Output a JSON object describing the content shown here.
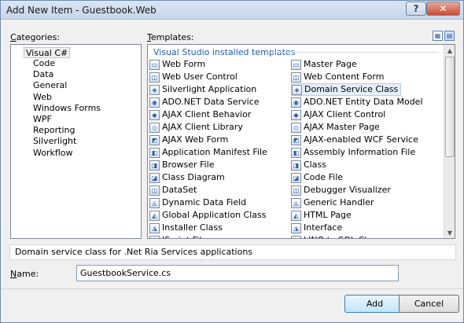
{
  "window": {
    "title": "Add New Item - Guestbook.Web"
  },
  "titlebar": {
    "help": "?",
    "close": "✕"
  },
  "categories": {
    "label_pre": "",
    "label_key": "C",
    "label_post": "ategories:",
    "root": "Visual C#",
    "items": [
      "Code",
      "Data",
      "General",
      "Web",
      "Windows Forms",
      "WPF",
      "Reporting",
      "Silverlight",
      "Workflow"
    ]
  },
  "templates": {
    "label_key": "T",
    "label_post": "emplates:",
    "group_header": "Visual Studio installed templates",
    "left": [
      "Web Form",
      "Web User Control",
      "Silverlight Application",
      "ADO.NET Data Service",
      "AJAX Client Behavior",
      "AJAX Client Library",
      "AJAX Web Form",
      "Application Manifest File",
      "Browser File",
      "Class Diagram",
      "DataSet",
      "Dynamic Data Field",
      "Global Application Class",
      "Installer Class",
      "JScript File"
    ],
    "right": [
      "Master Page",
      "Web Content Form",
      "Domain Service Class",
      "ADO.NET Entity Data Model",
      "AJAX Client Control",
      "AJAX Master Page",
      "AJAX-enabled WCF Service",
      "Assembly Information File",
      "Class",
      "Code File",
      "Debugger Visualizer",
      "Generic Handler",
      "HTML Page",
      "Interface",
      "LINQ to SQL Classes"
    ],
    "selected": "Domain Service Class"
  },
  "description": "Domain service class for .Net Ria Services applications",
  "name": {
    "label_key": "N",
    "label_post": "ame:",
    "value": "GuestbookService.cs"
  },
  "buttons": {
    "add": "Add",
    "cancel": "Cancel"
  }
}
